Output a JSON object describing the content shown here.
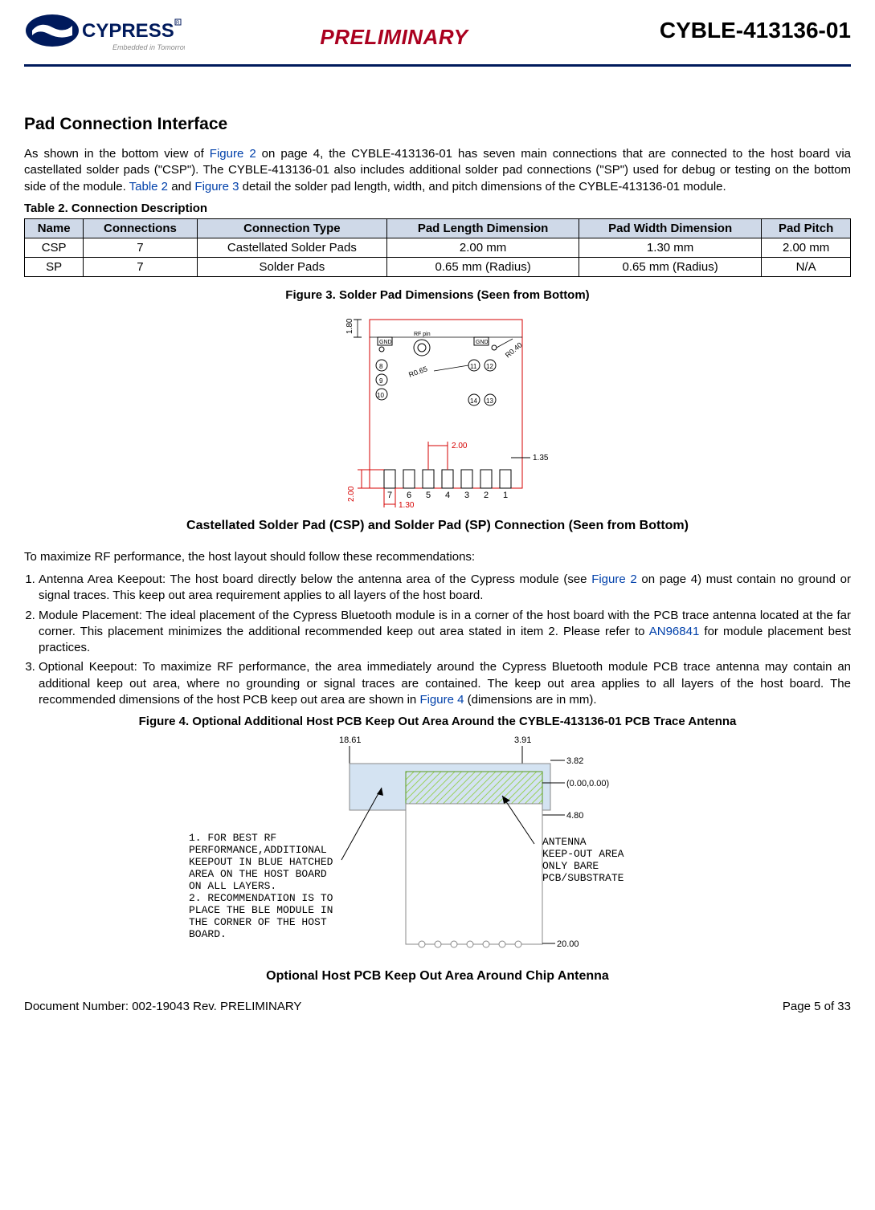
{
  "header": {
    "logo_main": "CYPRESS",
    "logo_tag": "Embedded in Tomorrow™",
    "preliminary": "PRELIMINARY",
    "part_number": "CYBLE-413136-01"
  },
  "section_title": "Pad Connection Interface",
  "intro": {
    "p1a": "As shown in the bottom view of ",
    "p1_link1": "Figure 2",
    "p1b": " on page 4, the CYBLE-413136-01 has seven main connections that are connected to the host board via castellated solder pads (\"CSP\"). The CYBLE-413136-01 also includes additional solder pad connections (\"SP\") used for debug or testing on the bottom side of the module. ",
    "p1_link2": "Table 2",
    "p1c": " and ",
    "p1_link3": "Figure 3",
    "p1d": " detail the solder pad length, width, and pitch dimensions of the CYBLE-413136-01 module."
  },
  "table2_caption": "Table 2.  Connection Description",
  "table2": {
    "headers": [
      "Name",
      "Connections",
      "Connection Type",
      "Pad Length Dimension",
      "Pad Width Dimension",
      "Pad Pitch"
    ],
    "rows": [
      [
        "CSP",
        "7",
        "Castellated Solder Pads",
        "2.00 mm",
        "1.30 mm",
        "2.00 mm"
      ],
      [
        "SP",
        "7",
        "Solder Pads",
        "0.65 mm (Radius)",
        "0.65 mm (Radius)",
        "N/A"
      ]
    ]
  },
  "fig3_caption": "Figure 3.  Solder Pad Dimensions (Seen from Bottom)",
  "fig3": {
    "dim_top": "1.80",
    "rf_pin": "RF pin",
    "gnd": "GND",
    "r065": "R0.65",
    "r040": "R0.40",
    "d200h": "2.00",
    "d135": "1.35",
    "d200v": "2.00",
    "d130": "1.30",
    "pad_nums_bottom": [
      "7",
      "6",
      "5",
      "4",
      "3",
      "2",
      "1"
    ],
    "sp_nums_left": [
      "8",
      "9",
      "10"
    ],
    "sp_nums_right_top": [
      "11",
      "12"
    ],
    "sp_nums_right_bot": [
      "14",
      "13"
    ]
  },
  "fig3_sub": "Castellated Solder Pad (CSP) and Solder Pad (SP) Connection (Seen from Bottom)",
  "rec_intro": "To maximize RF performance, the host layout should follow these recommendations:",
  "recs": {
    "r1a": "Antenna Area Keepout: The host board directly below the antenna area of the Cypress module (see ",
    "r1_link": "Figure 2",
    "r1b": " on page 4) must contain no ground or signal traces. This keep out area requirement applies to all layers of the host board.",
    "r2a": "Module Placement: The ideal placement of the Cypress Bluetooth module is in a corner of the host board with the PCB trace antenna located at the far corner. This placement minimizes the additional recommended keep out area stated in item 2. Please refer to ",
    "r2_link": "AN96841",
    "r2b": " for module placement best practices.",
    "r3a": "Optional Keepout: To maximize RF performance, the area immediately around the Cypress Bluetooth module PCB trace antenna may contain an additional keep out area, where no grounding or signal traces are contained. The keep out area applies to all layers of the host board. The recommended dimensions of the host PCB keep out area are shown in ",
    "r3_link": "Figure 4",
    "r3b": " (dimensions are in mm)."
  },
  "fig4_caption": "Figure 4.  Optional Additional Host PCB Keep Out Area Around the CYBLE-413136-01 PCB Trace Antenna",
  "fig4": {
    "d1861": "18.61",
    "d391": "3.91",
    "d382": "3.82",
    "origin": "(0.00,0.00)",
    "d480": "4.80",
    "d2000": "20.00",
    "note_left": "1. FOR BEST RF\nPERFORMANCE,ADDITIONAL\nKEEPOUT IN BLUE HATCHED\nAREA ON THE HOST BOARD\nON ALL LAYERS.\n2. RECOMMENDATION IS TO\nPLACE THE BLE MODULE IN\nTHE CORNER OF THE HOST\nBOARD.",
    "note_right": "ANTENNA\nKEEP-OUT AREA\nONLY BARE\nPCB/SUBSTRATE"
  },
  "fig4_sub": "Optional Host PCB Keep Out Area Around Chip Antenna",
  "footer": {
    "doc": "Document Number:  002-19043 Rev. PRELIMINARY",
    "page": "Page 5 of 33"
  }
}
